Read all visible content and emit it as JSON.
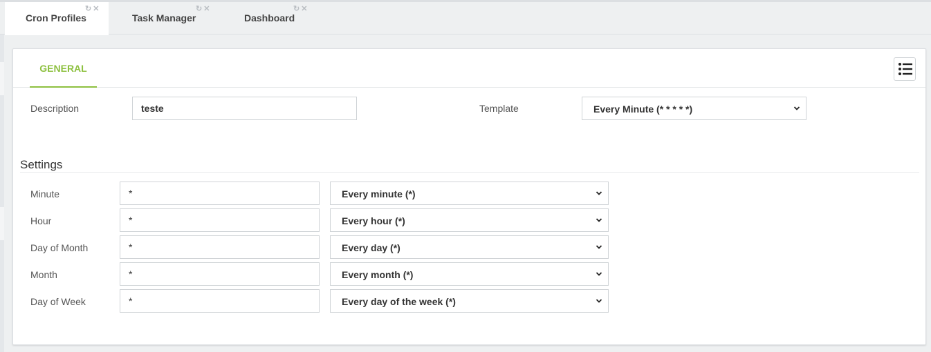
{
  "tabs": [
    {
      "label": "Cron Profiles",
      "active": true
    },
    {
      "label": "Task Manager",
      "active": false
    },
    {
      "label": "Dashboard",
      "active": false
    }
  ],
  "tab_controls": {
    "refresh_icon": "refresh-icon",
    "close_icon": "close-icon"
  },
  "panel": {
    "tab_general": "GENERAL",
    "list_button_icon": "list-icon"
  },
  "form": {
    "description_label": "Description",
    "description_value": "teste",
    "template_label": "Template",
    "template_value": "Every Minute (* * * * *)"
  },
  "settings": {
    "title": "Settings",
    "rows": [
      {
        "label": "Minute",
        "value": "*",
        "select": "Every minute (*)"
      },
      {
        "label": "Hour",
        "value": "*",
        "select": "Every hour (*)"
      },
      {
        "label": "Day of Month",
        "value": "*",
        "select": "Every day (*)"
      },
      {
        "label": "Month",
        "value": "*",
        "select": "Every month (*)"
      },
      {
        "label": "Day of Week",
        "value": "*",
        "select": "Every day of the week (*)"
      }
    ]
  },
  "colors": {
    "accent": "#8dc03f",
    "background": "#eef0f1"
  }
}
